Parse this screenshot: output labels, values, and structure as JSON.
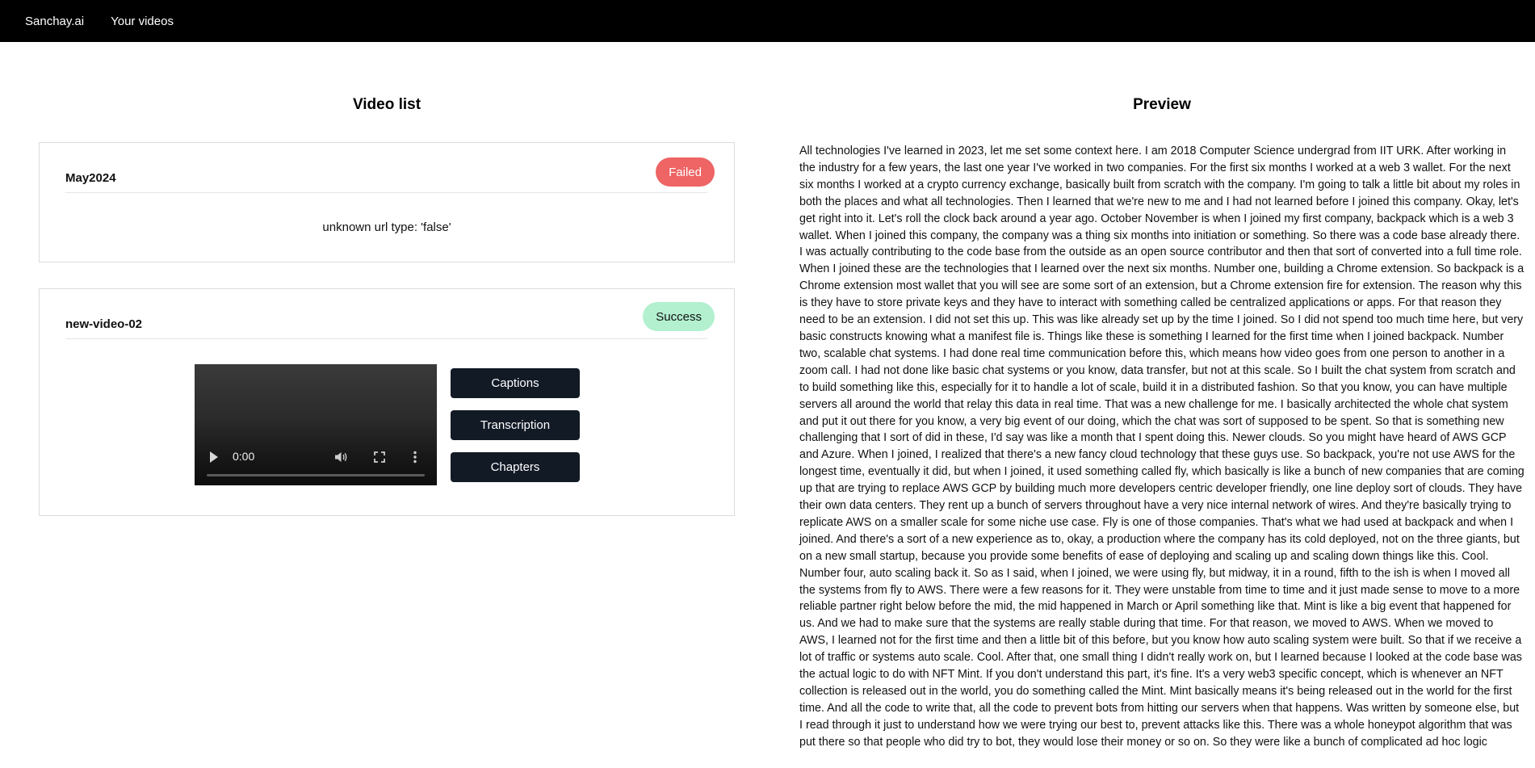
{
  "nav": {
    "brand": "Sanchay.ai",
    "links": [
      "Your videos"
    ]
  },
  "video_list": {
    "title": "Video list",
    "items": [
      {
        "name": "May2024",
        "status": "Failed",
        "status_color": "#ef6464",
        "message": "unknown url type: 'false'"
      },
      {
        "name": "new-video-02",
        "status": "Success",
        "status_color": "#b2f0d0",
        "player": {
          "time": "0:00",
          "icons": [
            "play-icon",
            "volume-icon",
            "fullscreen-icon",
            "more-options-icon"
          ]
        },
        "actions": [
          "Captions",
          "Transcription",
          "Chapters"
        ]
      }
    ]
  },
  "preview": {
    "title": "Preview",
    "text": "All technologies I've learned in 2023, let me set some context here. I am 2018 Computer Science undergrad from IIT URK. After working in the industry for a few years, the last one year I've worked in two companies. For the first six months I worked at a web 3 wallet. For the next six months I worked at a crypto currency exchange, basically built from scratch with the company. I'm going to talk a little bit about my roles in both the places and what all technologies. Then I learned that we're new to me and I had not learned before I joined this company. Okay, let's get right into it. Let's roll the clock back around a year ago. October November is when I joined my first company, backpack which is a web 3 wallet. When I joined this company, the company was a thing six months into initiation or something. So there was a code base already there. I was actually contributing to the code base from the outside as an open source contributor and then that sort of converted into a full time role. When I joined these are the technologies that I learned over the next six months. Number one, building a Chrome extension. So backpack is a Chrome extension most wallet that you will see are some sort of an extension, but a Chrome extension fire for extension. The reason why this is they have to store private keys and they have to interact with something called be centralized applications or apps. For that reason they need to be an extension. I did not set this up. This was like already set up by the time I joined. So I did not spend too much time here, but very basic constructs knowing what a manifest file is. Things like these is something I learned for the first time when I joined backpack. Number two, scalable chat systems. I had done real time communication before this, which means how video goes from one person to another in a zoom call. I had not done like basic chat systems or you know, data transfer, but not at this scale. So I built the chat system from scratch and to build something like this, especially for it to handle a lot of scale, build it in a distributed fashion. So that you know, you can have multiple servers all around the world that relay this data in real time. That was a new challenge for me. I basically architected the whole chat system and put it out there for you know, a very big event of our doing, which the chat was sort of supposed to be spent. So that is something new challenging that I sort of did in these, I'd say was like a month that I spent doing this. Newer clouds. So you might have heard of AWS GCP and Azure. When I joined, I realized that there's a new fancy cloud technology that these guys use. So backpack, you're not use AWS for the longest time, eventually it did, but when I joined, it used something called fly, which basically is like a bunch of new companies that are coming up that are trying to replace AWS GCP by building much more developers centric developer friendly, one line deploy sort of clouds. They have their own data centers. They rent up a bunch of servers throughout have a very nice internal network of wires. And they're basically trying to replicate AWS on a smaller scale for some niche use case. Fly is one of those companies. That's what we had used at backpack and when I joined. And there's a sort of a new experience as to, okay, a production where the company has its cold deployed, not on the three giants, but on a new small startup, because you provide some benefits of ease of deploying and scaling up and scaling down things like this. Cool. Number four, auto scaling back it. So as I said, when I joined, we were using fly, but midway, it in a round, fifth to the ish is when I moved all the systems from fly to AWS. There were a few reasons for it. They were unstable from time to time and it just made sense to move to a more reliable partner right below before the mid, the mid happened in March or April something like that. Mint is like a big event that happened for us. And we had to make sure that the systems are really stable during that time. For that reason, we moved to AWS. When we moved to AWS, I learned not for the first time and then a little bit of this before, but you know how auto scaling system were built. So that if we receive a lot of traffic or systems auto scale. Cool. After that, one small thing I didn't really work on, but I learned because I looked at the code base was the actual logic to do with NFT Mint. If you don't understand this part, it's fine. It's a very web3 specific concept, which is whenever an NFT collection is released out in the world, you do something called the Mint. Mint basically means it's being released out in the world for the first time. And all the code to write that, all the code to prevent bots from hitting our servers when that happens. Was written by someone else, but I read through it just to understand how we were trying our best to, prevent attacks like this. There was a whole honeypot algorithm that was put there so that people who did try to bot, they would lose their money or so on. So they were like a bunch of complicated ad hoc logic"
  }
}
